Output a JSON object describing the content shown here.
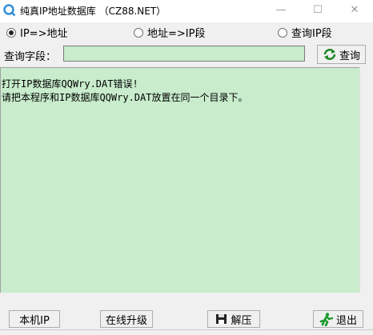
{
  "window": {
    "title": "纯真IP地址数据库 （CZ88.NET）",
    "min_glyph": "—",
    "max_glyph": "☐",
    "close_glyph": "✕"
  },
  "search": {
    "modes": [
      {
        "label": "IP=>地址",
        "selected": true
      },
      {
        "label": "地址=>IP段",
        "selected": false
      },
      {
        "label": "查询IP段",
        "selected": false
      }
    ],
    "field_label": "查询字段：",
    "field_value": "",
    "query_button": "查询"
  },
  "result": {
    "lines": [
      "打开IP数据库QQWry.DAT错误!",
      "请把本程序和IP数据库QQWry.DAT放置在同一个目录下。"
    ]
  },
  "buttons": {
    "local_ip": "本机IP",
    "online_upgrade": "在线升级",
    "extract": "解压",
    "exit": "退出"
  },
  "colors": {
    "result_background": "#c8eccc",
    "window_background": "#f0f0f0"
  }
}
